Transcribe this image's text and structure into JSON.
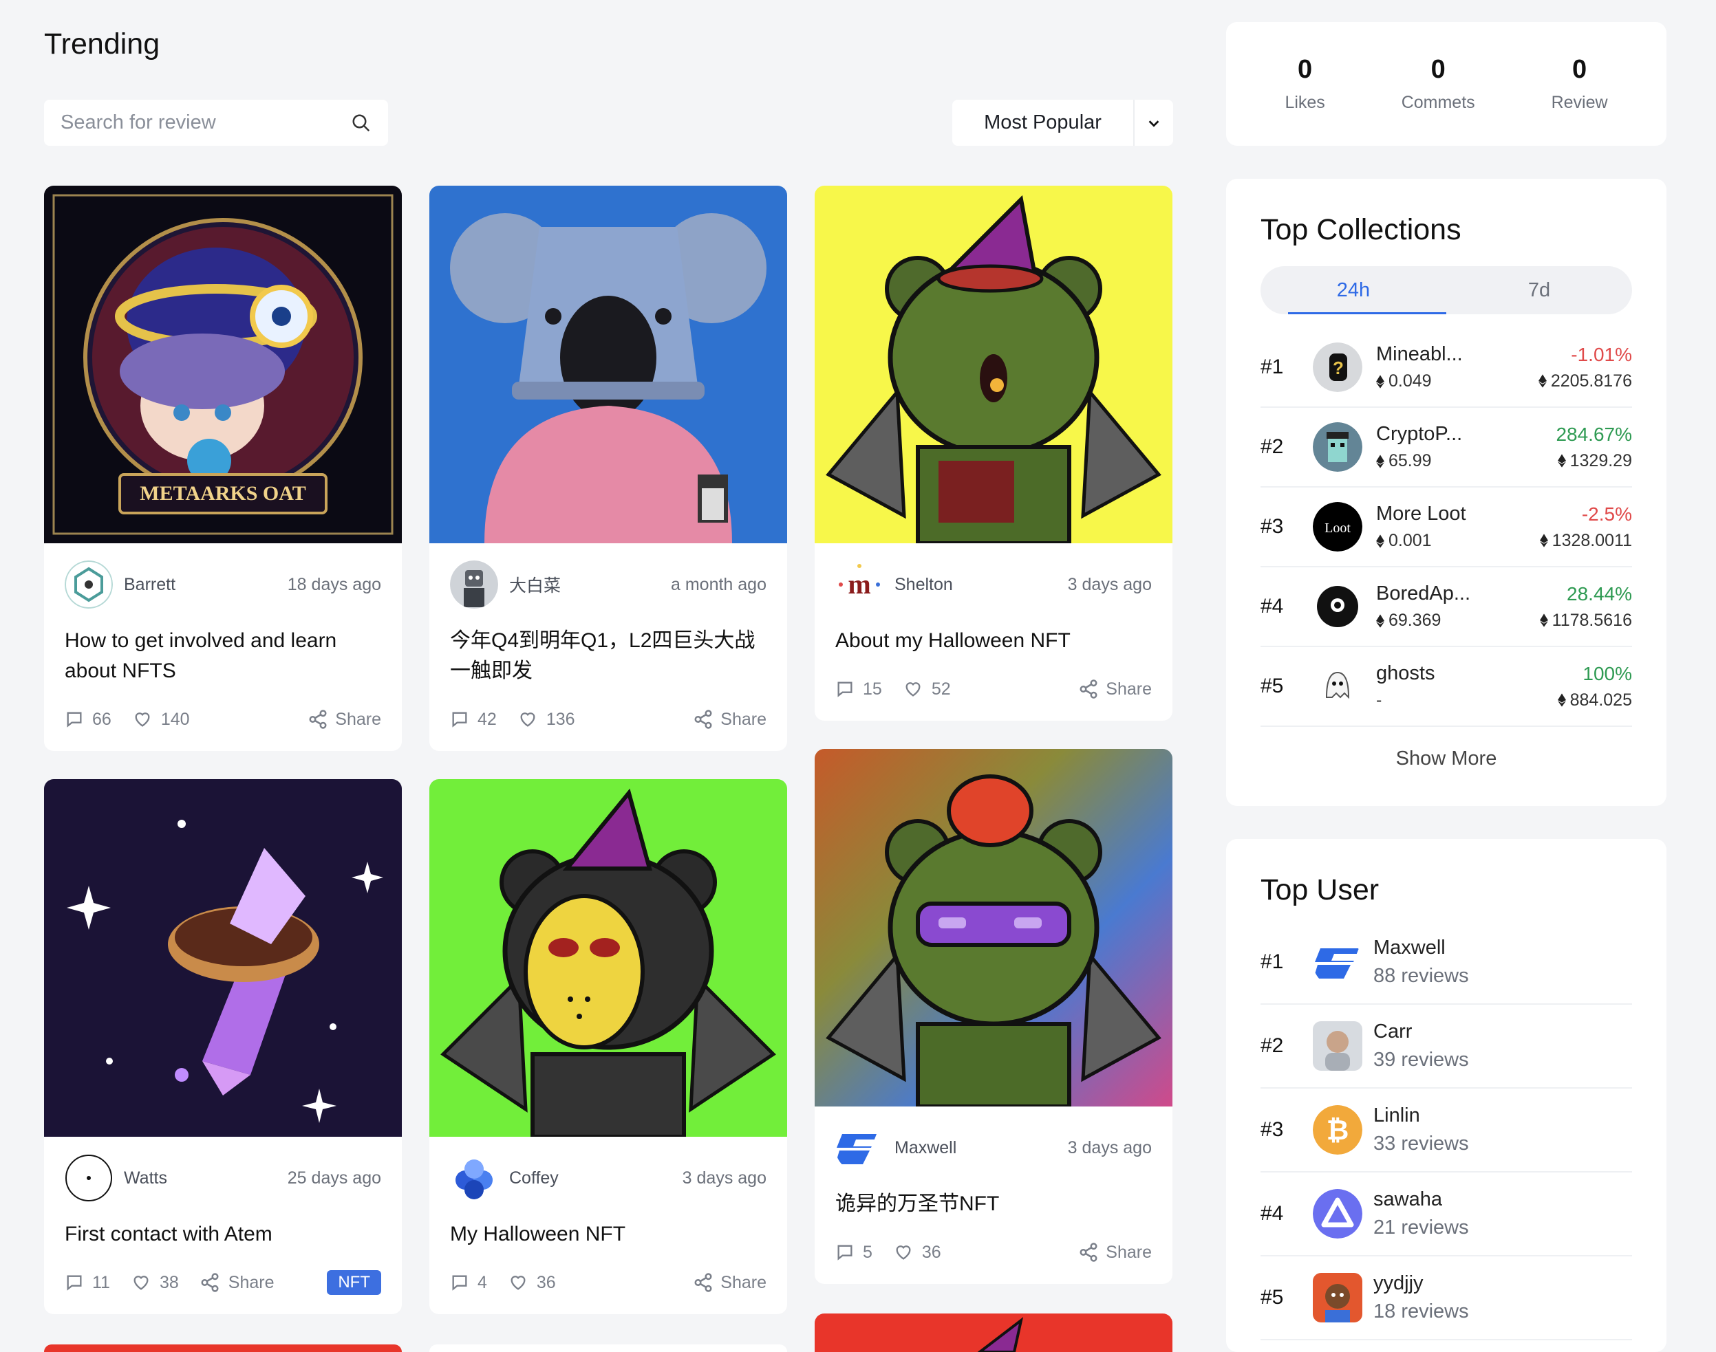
{
  "page": {
    "title": "Trending"
  },
  "search": {
    "placeholder": "Search for review"
  },
  "sort": {
    "selected": "Most Popular"
  },
  "cards": [
    {
      "author": "Barrett",
      "time": "18 days ago",
      "title": "How to get involved and learn about NFTS",
      "comments": "66",
      "likes": "140",
      "share": "Share",
      "art_text": "METAARKS OAT"
    },
    {
      "author": "大白菜",
      "time": "a month ago",
      "title": "今年Q4到明年Q1，L2四巨头大战一触即发",
      "comments": "42",
      "likes": "136",
      "share": "Share"
    },
    {
      "author": "Shelton",
      "time": "3 days ago",
      "title": "About my Halloween NFT",
      "comments": "15",
      "likes": "52",
      "share": "Share"
    },
    {
      "author": "Watts",
      "time": "25 days ago",
      "title": "First contact with Atem",
      "comments": "11",
      "likes": "38",
      "share": "Share",
      "badge": "NFT"
    },
    {
      "author": "Coffey",
      "time": "3 days ago",
      "title": "My Halloween NFT",
      "comments": "4",
      "likes": "36",
      "share": "Share"
    },
    {
      "author": "Maxwell",
      "time": "3 days ago",
      "title": "诡异的万圣节NFT",
      "comments": "5",
      "likes": "36",
      "share": "Share"
    }
  ],
  "stats": [
    {
      "value": "0",
      "label": "Likes"
    },
    {
      "value": "0",
      "label": "Commets"
    },
    {
      "value": "0",
      "label": "Review"
    }
  ],
  "collections": {
    "title": "Top Collections",
    "tabs": [
      "24h",
      "7d"
    ],
    "active_tab": "24h",
    "rows": [
      {
        "rank": "#1",
        "name": "Mineabl...",
        "floor": "0.049",
        "change": "-1.01%",
        "trend": "neg",
        "volume": "2205.8176"
      },
      {
        "rank": "#2",
        "name": "CryptoP...",
        "floor": "65.99",
        "change": "284.67%",
        "trend": "pos",
        "volume": "1329.29"
      },
      {
        "rank": "#3",
        "name": "More Loot",
        "floor": "0.001",
        "change": "-2.5%",
        "trend": "neg",
        "volume": "1328.0011",
        "icon_text": "Loot"
      },
      {
        "rank": "#4",
        "name": "BoredAp...",
        "floor": "69.369",
        "change": "28.44%",
        "trend": "pos",
        "volume": "1178.5616"
      },
      {
        "rank": "#5",
        "name": "ghosts",
        "floor": "-",
        "change": "100%",
        "trend": "pos",
        "volume": "884.025"
      }
    ],
    "show_more": "Show More"
  },
  "top_user": {
    "title": "Top User",
    "rows": [
      {
        "rank": "#1",
        "name": "Maxwell",
        "reviews": "88 reviews"
      },
      {
        "rank": "#2",
        "name": "Carr",
        "reviews": "39 reviews"
      },
      {
        "rank": "#3",
        "name": "Linlin",
        "reviews": "33 reviews"
      },
      {
        "rank": "#4",
        "name": "sawaha",
        "reviews": "21 reviews"
      },
      {
        "rank": "#5",
        "name": "yydjjy",
        "reviews": "18 reviews"
      }
    ]
  },
  "colors": {
    "accent": "#2e6ae6",
    "negative": "#e04a4a",
    "positive": "#2e9a52",
    "badge": "#3d6fe0"
  }
}
